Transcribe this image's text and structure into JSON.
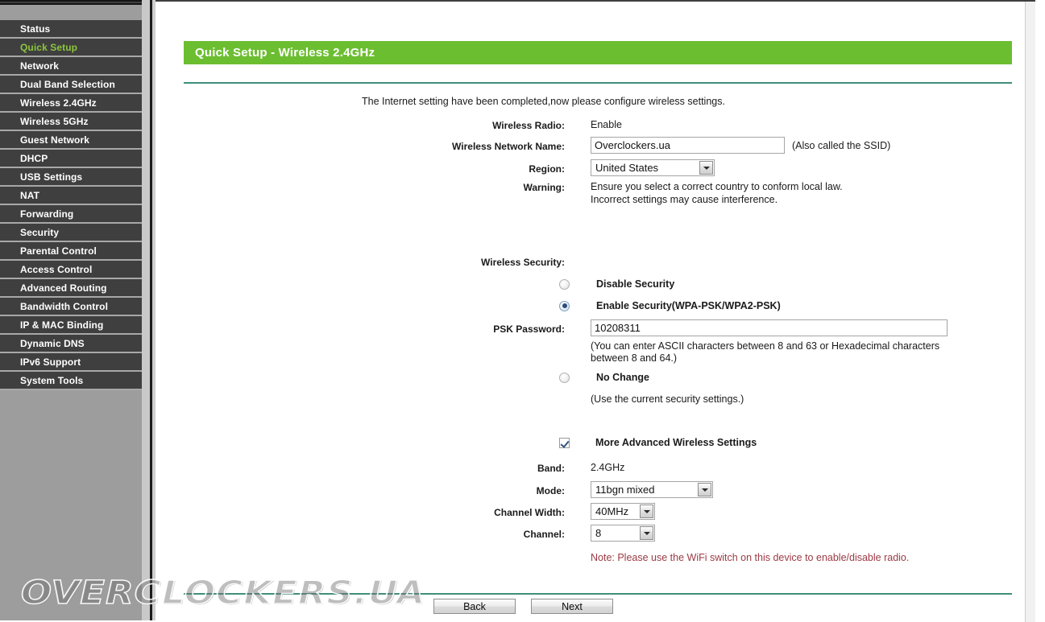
{
  "sidebar": {
    "items": [
      {
        "label": "Status",
        "active": false
      },
      {
        "label": "Quick Setup",
        "active": true
      },
      {
        "label": "Network",
        "active": false
      },
      {
        "label": "Dual Band Selection",
        "active": false
      },
      {
        "label": "Wireless 2.4GHz",
        "active": false
      },
      {
        "label": "Wireless 5GHz",
        "active": false
      },
      {
        "label": "Guest Network",
        "active": false
      },
      {
        "label": "DHCP",
        "active": false
      },
      {
        "label": "USB Settings",
        "active": false
      },
      {
        "label": "NAT",
        "active": false
      },
      {
        "label": "Forwarding",
        "active": false
      },
      {
        "label": "Security",
        "active": false
      },
      {
        "label": "Parental Control",
        "active": false
      },
      {
        "label": "Access Control",
        "active": false
      },
      {
        "label": "Advanced Routing",
        "active": false
      },
      {
        "label": "Bandwidth Control",
        "active": false
      },
      {
        "label": "IP & MAC Binding",
        "active": false
      },
      {
        "label": "Dynamic DNS",
        "active": false
      },
      {
        "label": "IPv6 Support",
        "active": false
      },
      {
        "label": "System Tools",
        "active": false
      }
    ]
  },
  "page": {
    "title": "Quick Setup - Wireless 2.4GHz",
    "intro": "The Internet setting have been completed,now please configure wireless settings.",
    "accent_color": "#6cbe31",
    "divider_color": "#3e8f7c"
  },
  "form": {
    "wireless_radio_label": "Wireless Radio:",
    "wireless_radio_value": "Enable",
    "ssid_label": "Wireless Network Name:",
    "ssid_value": "Overclockers.ua",
    "ssid_placeholder": "",
    "ssid_hint": "(Also called the SSID)",
    "region_label": "Region:",
    "region_value": "United States",
    "warning_label": "Warning:",
    "warning_line1": "Ensure you select a correct country to conform local law.",
    "warning_line2": "Incorrect settings may cause interference."
  },
  "security": {
    "section_label": "Wireless Security:",
    "option_disable": "Disable Security",
    "option_enable": "Enable Security(WPA-PSK/WPA2-PSK)",
    "option_nochange": "No Change",
    "selected": "enable",
    "psk_label": "PSK Password:",
    "psk_value": "10208311",
    "psk_placeholder": "",
    "psk_hint_line1": "(You can enter ASCII characters between 8 and 63 or Hexadecimal characters",
    "psk_hint_line2": "between 8 and 64.)",
    "nochange_hint": "(Use the current security settings.)"
  },
  "advanced": {
    "checkbox_label": "More Advanced Wireless Settings",
    "checkbox_checked": true,
    "band_label": "Band:",
    "band_value": "2.4GHz",
    "mode_label": "Mode:",
    "mode_value": "11bgn mixed",
    "channel_width_label": "Channel Width:",
    "channel_width_value": "40MHz",
    "channel_label": "Channel:",
    "channel_value": "8",
    "note": "Note: Please use the WiFi switch on this device to enable/disable radio.",
    "note_color": "#9b3a44"
  },
  "footer": {
    "back_label": "Back",
    "next_label": "Next"
  },
  "watermark": {
    "text": "OVERCLOCKERS.UA"
  }
}
